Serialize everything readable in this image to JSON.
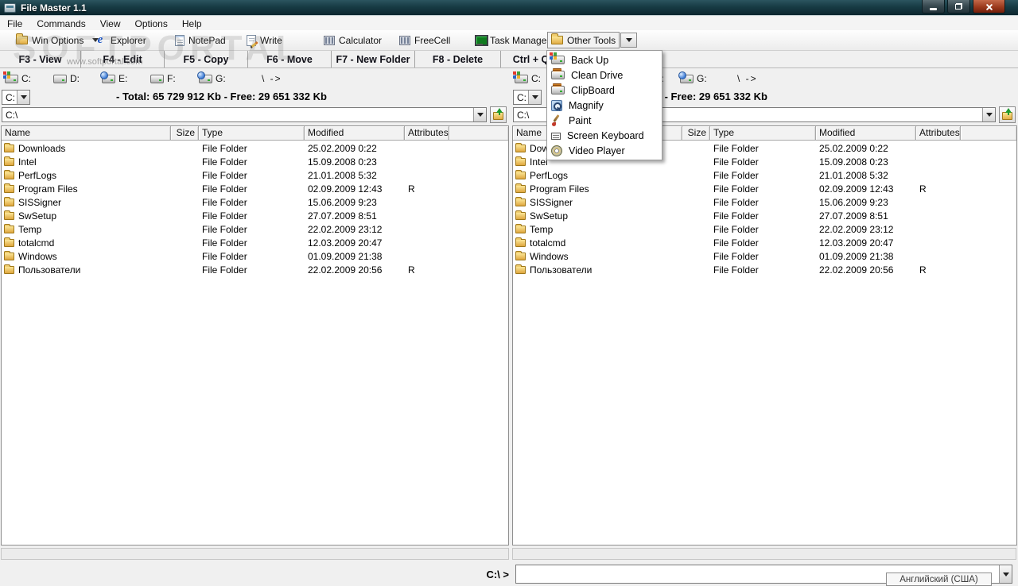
{
  "window": {
    "title": "File Master 1.1"
  },
  "menubar": {
    "items": [
      "File",
      "Commands",
      "View",
      "Options",
      "Help"
    ]
  },
  "toolbar": {
    "buttons": [
      {
        "label": "Win Options"
      },
      {
        "label": "Explorer"
      },
      {
        "label": "NotePad"
      },
      {
        "label": "Write"
      },
      {
        "label": "Calculator"
      },
      {
        "label": "FreeCell"
      },
      {
        "label": "Task Manager"
      },
      {
        "label": "Other Tools"
      }
    ]
  },
  "function_bar": {
    "items": [
      "F3 - View",
      "F4 - Edit",
      "F5 - Copy",
      "F6 - Move",
      "F7 - New Folder",
      "F8 - Delete",
      "Ctrl + Q"
    ]
  },
  "pane": {
    "drives": [
      {
        "label": "C:",
        "icon": "drive-windows-icon"
      },
      {
        "label": "D:",
        "icon": "drive-icon"
      },
      {
        "label": "E:",
        "icon": "drive-globe-icon"
      },
      {
        "label": "F:",
        "icon": "drive-icon"
      },
      {
        "label": "G:",
        "icon": "drive-globe-icon"
      }
    ],
    "drive_arrow": "\\ ->",
    "drive_combo": "C:",
    "stats": "- Total: 65 729 912 Kb - Free: 29 651 332 Kb",
    "path": "C:\\",
    "columns": [
      "Name",
      "Size",
      "Type",
      "Modified",
      "Attributes"
    ],
    "rows": [
      {
        "name": "Downloads",
        "size": "",
        "type": "File Folder",
        "modified": "25.02.2009 0:22",
        "attributes": ""
      },
      {
        "name": "Intel",
        "size": "",
        "type": "File Folder",
        "modified": "15.09.2008 0:23",
        "attributes": ""
      },
      {
        "name": "PerfLogs",
        "size": "",
        "type": "File Folder",
        "modified": "21.01.2008 5:32",
        "attributes": ""
      },
      {
        "name": "Program Files",
        "size": "",
        "type": "File Folder",
        "modified": "02.09.2009 12:43",
        "attributes": "R"
      },
      {
        "name": "SISSigner",
        "size": "",
        "type": "File Folder",
        "modified": "15.06.2009 9:23",
        "attributes": ""
      },
      {
        "name": "SwSetup",
        "size": "",
        "type": "File Folder",
        "modified": "27.07.2009 8:51",
        "attributes": ""
      },
      {
        "name": "Temp",
        "size": "",
        "type": "File Folder",
        "modified": "22.02.2009 23:12",
        "attributes": ""
      },
      {
        "name": "totalcmd",
        "size": "",
        "type": "File Folder",
        "modified": "12.03.2009 20:47",
        "attributes": ""
      },
      {
        "name": "Windows",
        "size": "",
        "type": "File Folder",
        "modified": "01.09.2009 21:38",
        "attributes": ""
      },
      {
        "name": "Пользователи",
        "size": "",
        "type": "File Folder",
        "modified": "22.02.2009 20:56",
        "attributes": "R"
      }
    ]
  },
  "tools_menu": {
    "items": [
      {
        "label": "Back Up",
        "icon": "backup-drive-icon"
      },
      {
        "label": "Clean Drive",
        "icon": "clean-drive-icon"
      },
      {
        "label": "ClipBoard",
        "icon": "clipboard-drive-icon"
      },
      {
        "label": "Magnify",
        "icon": "magnify-icon"
      },
      {
        "label": "Paint",
        "icon": "paint-icon"
      },
      {
        "label": "Screen Keyboard",
        "icon": "keyboard-icon"
      },
      {
        "label": "Video Player",
        "icon": "dvd-icon"
      }
    ]
  },
  "command_bar": {
    "prompt": "C:\\ >",
    "input_value": "",
    "language_indicator": "Английский (США)"
  },
  "watermark": {
    "title": "SOFTPORTAL",
    "url": "www.softportal.com"
  }
}
